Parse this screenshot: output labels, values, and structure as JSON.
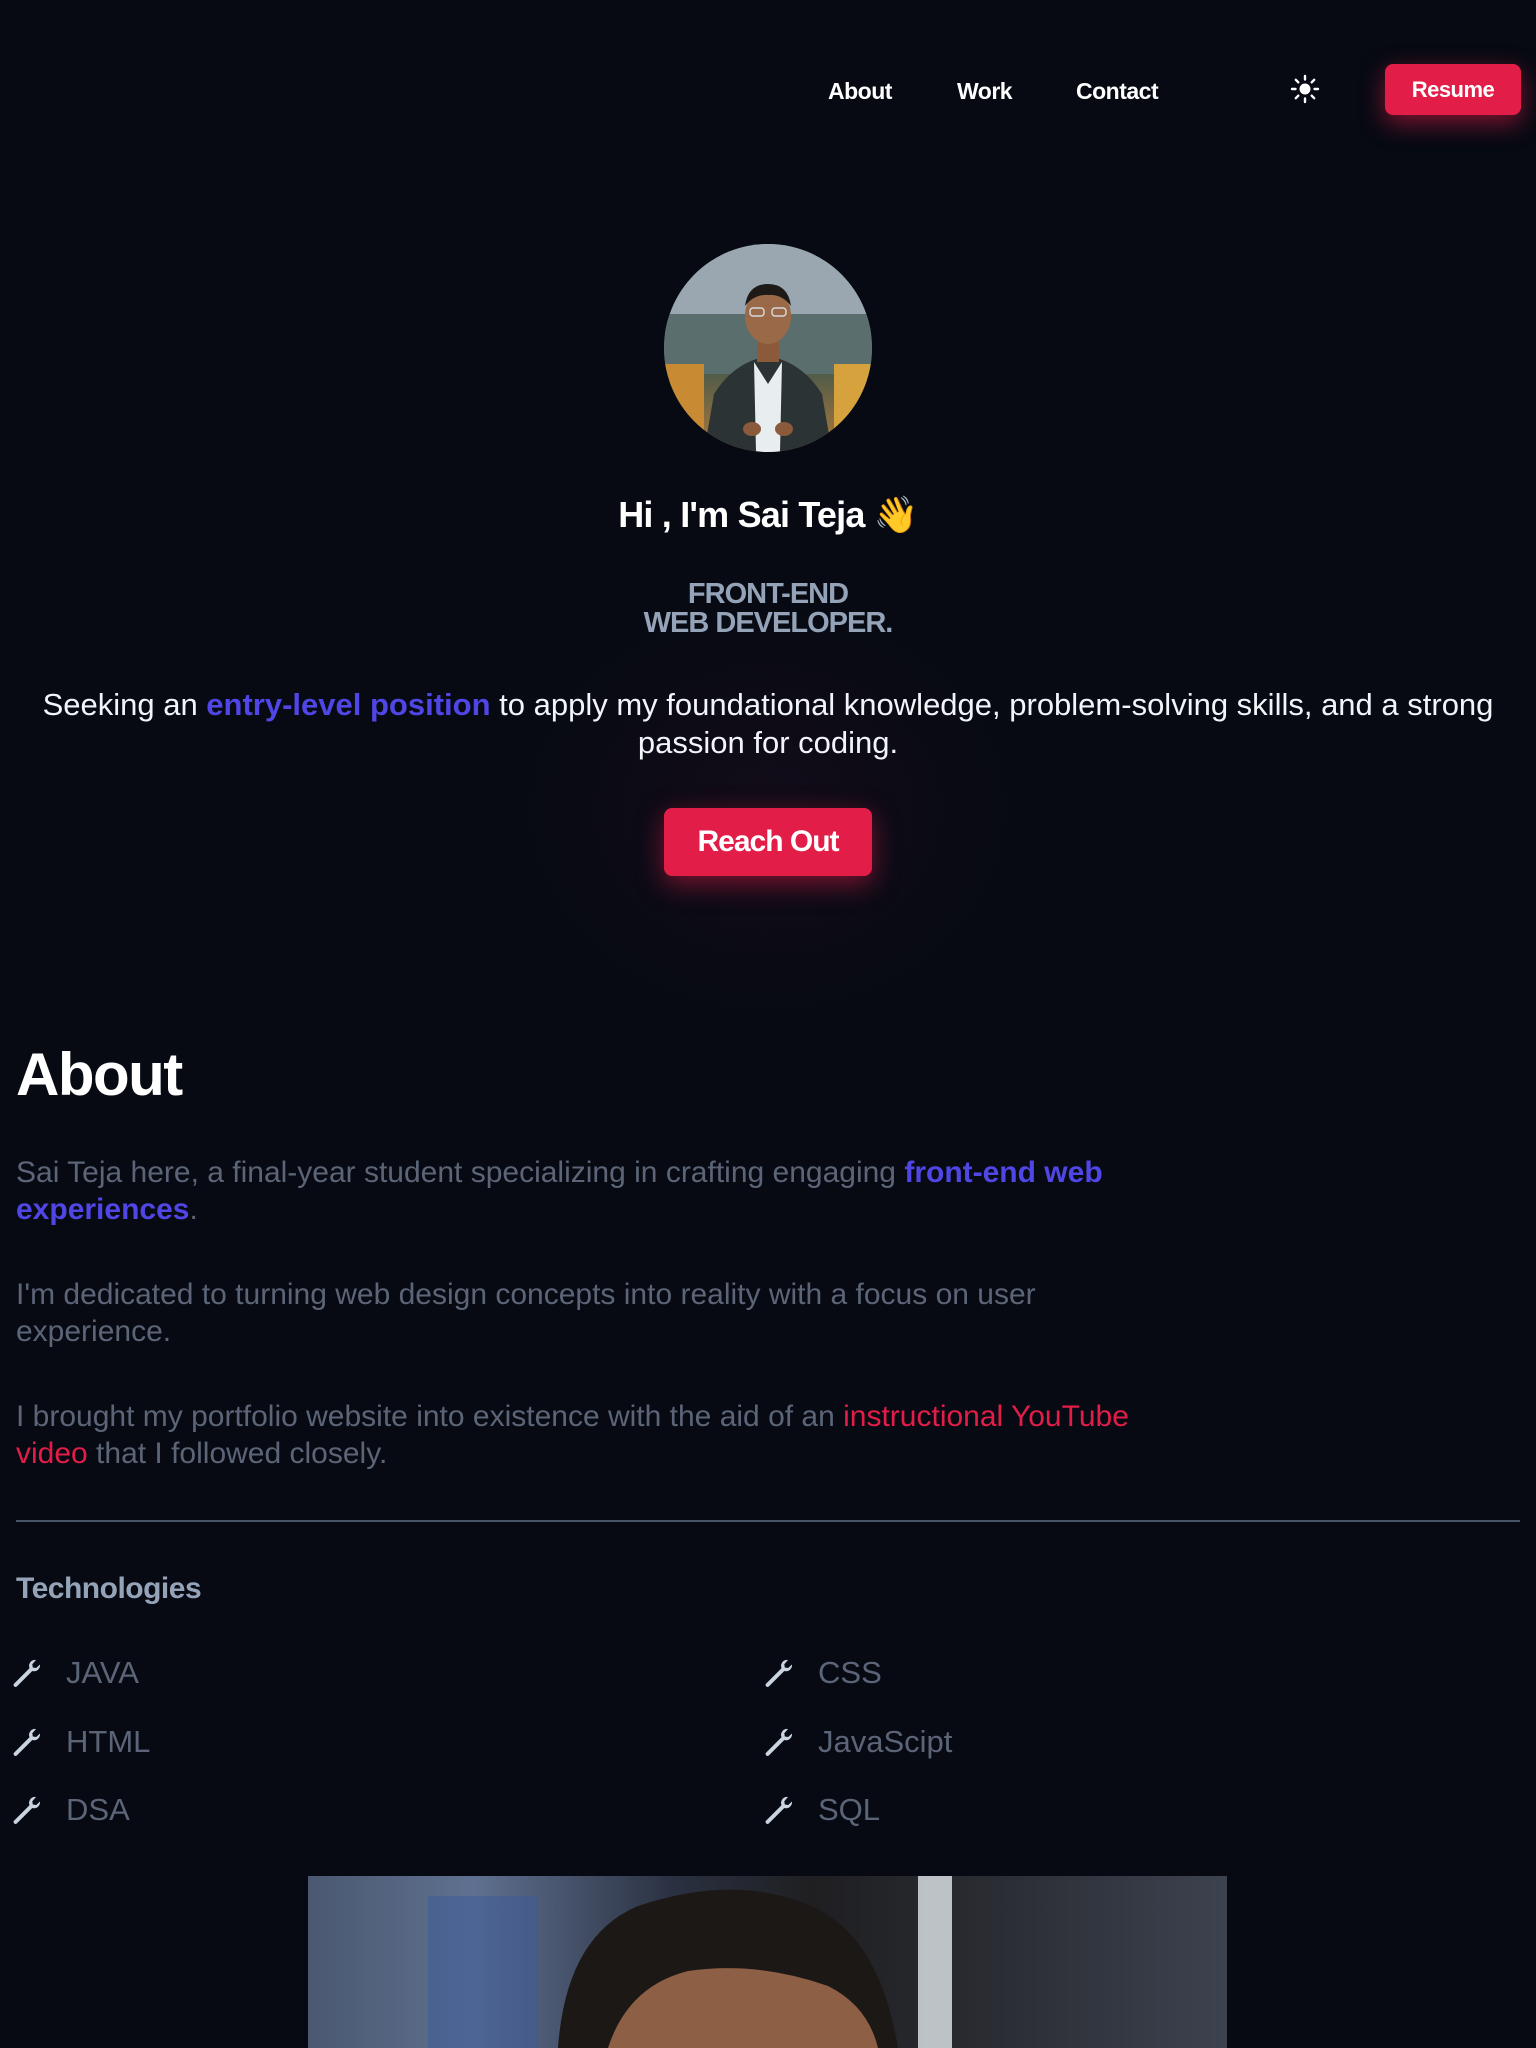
{
  "nav": {
    "links": [
      "About",
      "Work",
      "Contact"
    ],
    "theme_icon": "sun-icon",
    "resume_label": "Resume"
  },
  "hero": {
    "title": "Hi , I'm Sai Teja 👋",
    "role_line1": "FRONT-END",
    "role_line2": "WEB DEVELOPER.",
    "desc_before": "Seeking an ",
    "desc_highlight": "entry-level position",
    "desc_after": " to apply my foundational knowledge, problem-solving skills, and a strong passion for coding.",
    "cta_label": "Reach Out"
  },
  "about": {
    "heading": "About",
    "p1_before": "Sai Teja here, a final-year student specializing in crafting engaging ",
    "p1_highlight": "front-end web experiences",
    "p1_after": ".",
    "p2": "I'm dedicated to turning web design concepts into reality with a focus on user experience.",
    "p3_before": "I brought my portfolio website into existence with the aid of an ",
    "p3_link": "instructional YouTube video",
    "p3_after": " that I followed closely."
  },
  "technologies": {
    "heading": "Technologies",
    "icon": "wrench-icon",
    "items": [
      "JAVA",
      "CSS",
      "HTML",
      "JavaScipt",
      "DSA",
      "SQL"
    ]
  },
  "colors": {
    "background": "#070a13",
    "accent": "#e11d48",
    "highlight": "#4f46e5",
    "muted": "#5b6577"
  }
}
